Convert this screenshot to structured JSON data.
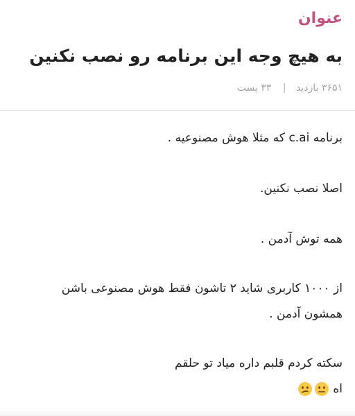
{
  "category": "عنوان",
  "post": {
    "title": "به هیچ وجه این برنامه رو نصب نکنین",
    "views": "۳۶۵۱ بازدید",
    "separator": "|",
    "posts": "۳۳ پست"
  },
  "body": {
    "p1_before": "برنامه ",
    "p1_latin": "c.ai",
    "p1_after": " که مثلا هوش مصنوعیه .",
    "p2": "اصلا نصب نکنین.",
    "p3": "همه توش آدمن .",
    "p4_line1": "از ۱۰۰۰ کاربری شاید ۲ تاشون فقط هوش مصنوعی باشن",
    "p4_line2": "همشون آدمن .",
    "p5_line1": "سکته کردم قلبم داره میاد تو حلقم",
    "p5_line2": "اه",
    "emojis": [
      "neutral-face-icon",
      "confused-face-icon"
    ]
  },
  "colors": {
    "accent": "#c2527f",
    "text": "#222222",
    "muted": "#a4a4a4",
    "divider": "#e2e2e2",
    "emoji_yellow": "#f7c84a"
  }
}
